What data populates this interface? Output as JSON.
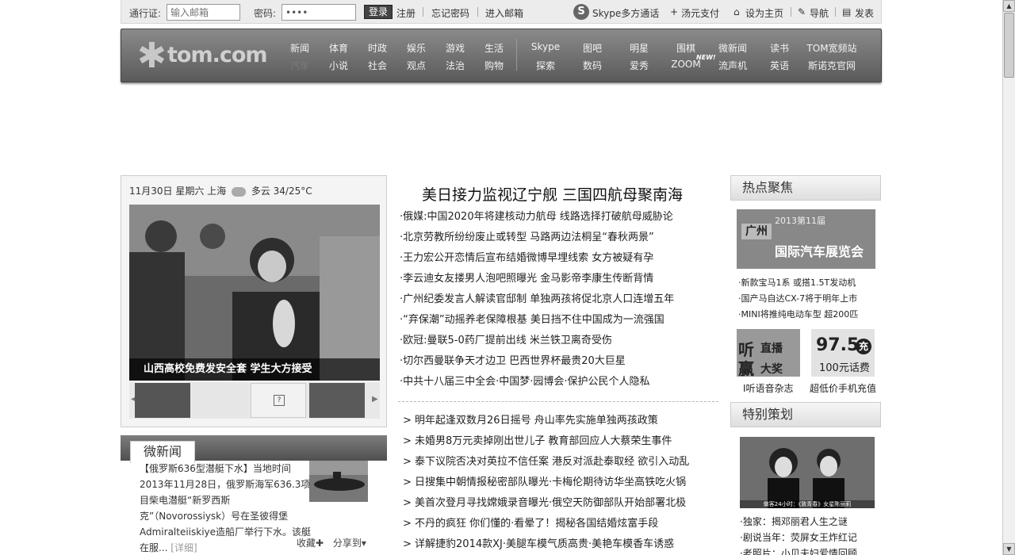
{
  "topbar": {
    "pass_label": "通行证:",
    "email_placeholder": "输入邮箱",
    "pwd_label": "密码:",
    "pwd_value": "••••",
    "login": "登录",
    "register": "注册",
    "forgot": "忘记密码",
    "enter_mail": "进入邮箱",
    "skype": "Skype多方通话",
    "soup_pay": "汤元支付",
    "set_home": "设为主页",
    "nav": "导航",
    "post": "发表"
  },
  "logo": {
    "text": "tom.com"
  },
  "nav": {
    "row1": [
      "新闻",
      "体育",
      "时政",
      "娱乐",
      "游戏",
      "生活",
      "Skype",
      "图吧",
      "明星",
      "围棋",
      "微新闻",
      "读书",
      "TOM宽频站"
    ],
    "row2": [
      "汽车",
      "小说",
      "社会",
      "观点",
      "法治",
      "购物",
      "探索",
      "数码",
      "爱秀",
      "ZOOM",
      "流声机",
      "英语",
      "斯诺克官网"
    ],
    "new_badge": "NEW!"
  },
  "weather": {
    "text": "11月30日 星期六 上海",
    "cond": "多云 34/25°C"
  },
  "main_photo_caption": "山西高校免费发安全套 学生大方接受",
  "news_box": {
    "tab": "微新闻",
    "body": "【俄罗斯636型潜艇下水】当地时间2013年11月28日，俄罗斯海军636.3项目柴电潜艇“新罗西斯克”（Novorossiysk）号在圣彼得堡Admiralteiiskiye造船厂举行下水。该艇在服...",
    "more": "[详细]",
    "collect": "收藏",
    "share": "分享到"
  },
  "headline": "美日接力监视辽宁舰 三国四航母聚南海",
  "mid_list_1": [
    "·俄媒:中国2020年将建核动力航母 线路选择打破航母威胁论",
    "·北京劳教所纷纷废止或转型 马路两边法桐呈“春秋两景”",
    "·王力宏公开恋情后宣布结婚微博早埋线索 女方被疑有孕",
    "·李云迪女友搂男人泡吧照曝光 金马影帝李康生传断背情",
    "·广州纪委发言人解读官邸制 单独两孩将促北京人口连增五年",
    "·“弃保潮”动摇养老保障根基 美日挡不住中国成为一流强国",
    "·欧冠:曼联5-0药厂提前出线 米兰铁卫离奇受伤",
    "·切尔西曼联争天才边卫 巴西世界杯最贵20大巨星",
    "·中共十八届三中全会·中国梦·园博会·保护公民个人隐私"
  ],
  "mid_list_2": [
    "> 明年起逢双数月26日摇号 舟山率先实施单独两孩政策",
    "> 未婚男8万元卖掉刚出世儿子 教育部回应人大蔡荣生事件",
    "> 泰下议院否决对英拉不信任案 港反对派赴泰取经 欲引入动乱",
    "> 日搜集中朝情报秘密部队曝光·卡梅伦期待访华坐高铁吃火锅",
    "> 美首次登月寻找嫦娥录音曝光·俄空天防御部队开始部署北极",
    "> 不丹的疯狂 你们懂的·看晕了！揭秘各国结婚炫富手段",
    "> 详解捷豹2014款XJ·美腿车模气质高贵·美艳车模香车诱惑"
  ],
  "right": {
    "hot_title": "热点聚焦",
    "expo_year": "2013第11届",
    "expo_city": "广州",
    "expo_name": "国际汽车展览会",
    "car_links": [
      "·新款宝马1系 或搭1.5T发动机",
      "·国产马自达CX-7将于明年上市",
      "·MINI将推纯电动车型 超200匹"
    ],
    "promo_a_1": "听",
    "promo_a_2": "直播",
    "promo_a_3": "赢",
    "promo_a_4": "大奖",
    "promo_a_caption": "I听语音杂志",
    "promo_b_price": "97.5",
    "promo_b_badge": "充",
    "promo_b_sub": "100元话费",
    "promo_b_caption": "超低价手机充值",
    "special_title": "特别策划",
    "special_photo_caption": "做客24小时：《致青春》女星陈丽莉",
    "special_links": [
      "·独家：揭邓丽君人生之谜",
      "·剧说当年：荧屏女王炸红记",
      "·老照片：小贝夫妇爱情回顾"
    ]
  }
}
